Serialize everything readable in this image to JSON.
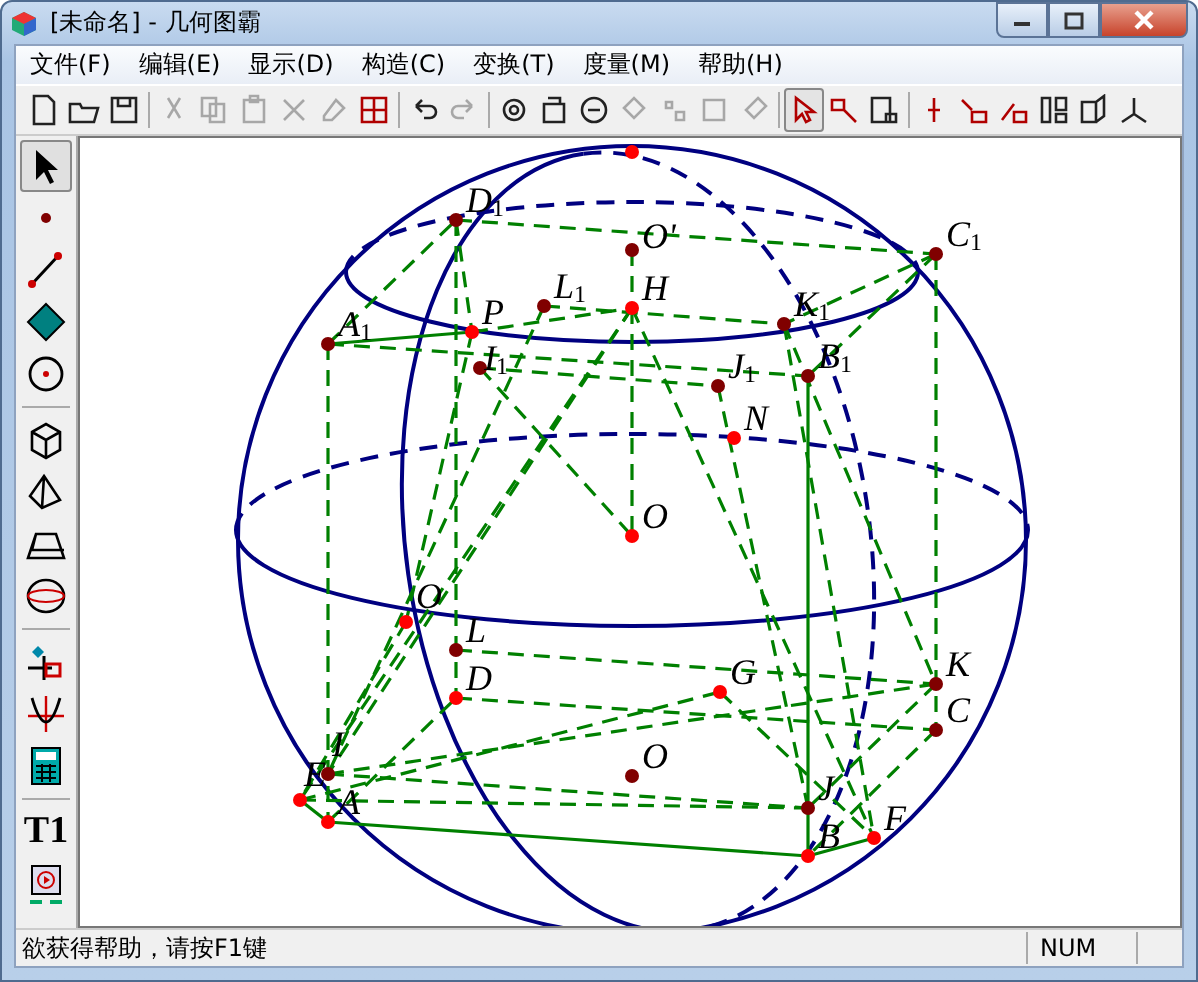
{
  "window": {
    "title": "[未命名] - 几何图霸"
  },
  "menu": [
    "文件(F)",
    "编辑(E)",
    "显示(D)",
    "构造(C)",
    "变换(T)",
    "度量(M)",
    "帮助(H)"
  ],
  "toolbar": [
    {
      "disabled": false,
      "selected": false
    },
    {
      "disabled": false,
      "selected": false
    },
    {
      "disabled": false,
      "selected": false
    },
    {
      "disabled": true,
      "selected": false
    },
    {
      "disabled": true,
      "selected": false
    },
    {
      "disabled": true,
      "selected": false
    },
    {
      "disabled": true,
      "selected": false
    },
    {
      "disabled": true,
      "selected": false
    },
    {
      "disabled": false,
      "selected": false
    },
    {
      "disabled": false,
      "selected": false
    },
    {
      "disabled": true,
      "selected": false
    },
    {
      "disabled": false,
      "selected": false
    },
    {
      "disabled": false,
      "selected": false
    },
    {
      "disabled": false,
      "selected": false
    },
    {
      "disabled": true,
      "selected": false
    },
    {
      "disabled": true,
      "selected": false
    },
    {
      "disabled": true,
      "selected": false
    },
    {
      "disabled": true,
      "selected": false
    },
    {
      "disabled": false,
      "selected": true
    },
    {
      "disabled": false,
      "selected": false
    },
    {
      "disabled": false,
      "selected": false
    },
    {
      "disabled": false,
      "selected": false
    },
    {
      "disabled": false,
      "selected": false
    },
    {
      "disabled": false,
      "selected": false
    },
    {
      "disabled": false,
      "selected": false
    },
    {
      "disabled": false,
      "selected": false
    },
    {
      "disabled": false,
      "selected": false
    }
  ],
  "tools": [
    {
      "selected": true
    },
    {
      "selected": false
    },
    {
      "selected": false
    },
    {
      "selected": false
    },
    {
      "selected": false
    },
    {
      "selected": false
    },
    {
      "selected": false
    },
    {
      "selected": false
    },
    {
      "selected": false
    },
    {
      "selected": false
    },
    {
      "selected": false
    },
    {
      "selected": false
    },
    {
      "selected": false,
      "label": "T1"
    },
    {
      "selected": false
    }
  ],
  "points": [
    {
      "color": "#ff0000"
    },
    {
      "label": "D$_{1}$",
      "color": "#800000"
    },
    {
      "label": "C$_{1}$",
      "color": "#800000"
    },
    {
      "label": "O'",
      "color": "#800000"
    },
    {
      "label": "L$_{1}$",
      "color": "#800000"
    },
    {
      "label": "H",
      "color": "#ff0000"
    },
    {
      "label": "P",
      "color": "#ff0000"
    },
    {
      "label": "K$_{1}$",
      "color": "#800000"
    },
    {
      "label": "A$_{1}$",
      "color": "#800000"
    },
    {
      "label": "I$_{1}$",
      "color": "#800000"
    },
    {
      "label": "J$_{1}$",
      "color": "#800000"
    },
    {
      "label": "B$_{1}$",
      "color": "#800000"
    },
    {
      "label": "N",
      "color": "#ff0000"
    },
    {
      "label": "O",
      "color": "#ff0000"
    },
    {
      "label": "O",
      "color": "#ff0000"
    },
    {
      "label": "L",
      "color": "#800000"
    },
    {
      "label": "D",
      "color": "#ff0000"
    },
    {
      "label": "G",
      "color": "#ff0000"
    },
    {
      "label": "K",
      "color": "#800000"
    },
    {
      "label": "C",
      "color": "#800000"
    },
    {
      "label": "I",
      "color": "#800000"
    },
    {
      "label": "E",
      "color": "#ff0000"
    },
    {
      "label": "A",
      "color": "#ff0000"
    },
    {
      "label": "O",
      "color": "#800000"
    },
    {
      "label": "J",
      "color": "#800000"
    },
    {
      "label": "B",
      "color": "#ff0000"
    },
    {
      "label": "F",
      "color": "#ff0000"
    }
  ],
  "status_bar": {
    "help": "欲获得帮助，请按F1键",
    "num": "NUM"
  }
}
